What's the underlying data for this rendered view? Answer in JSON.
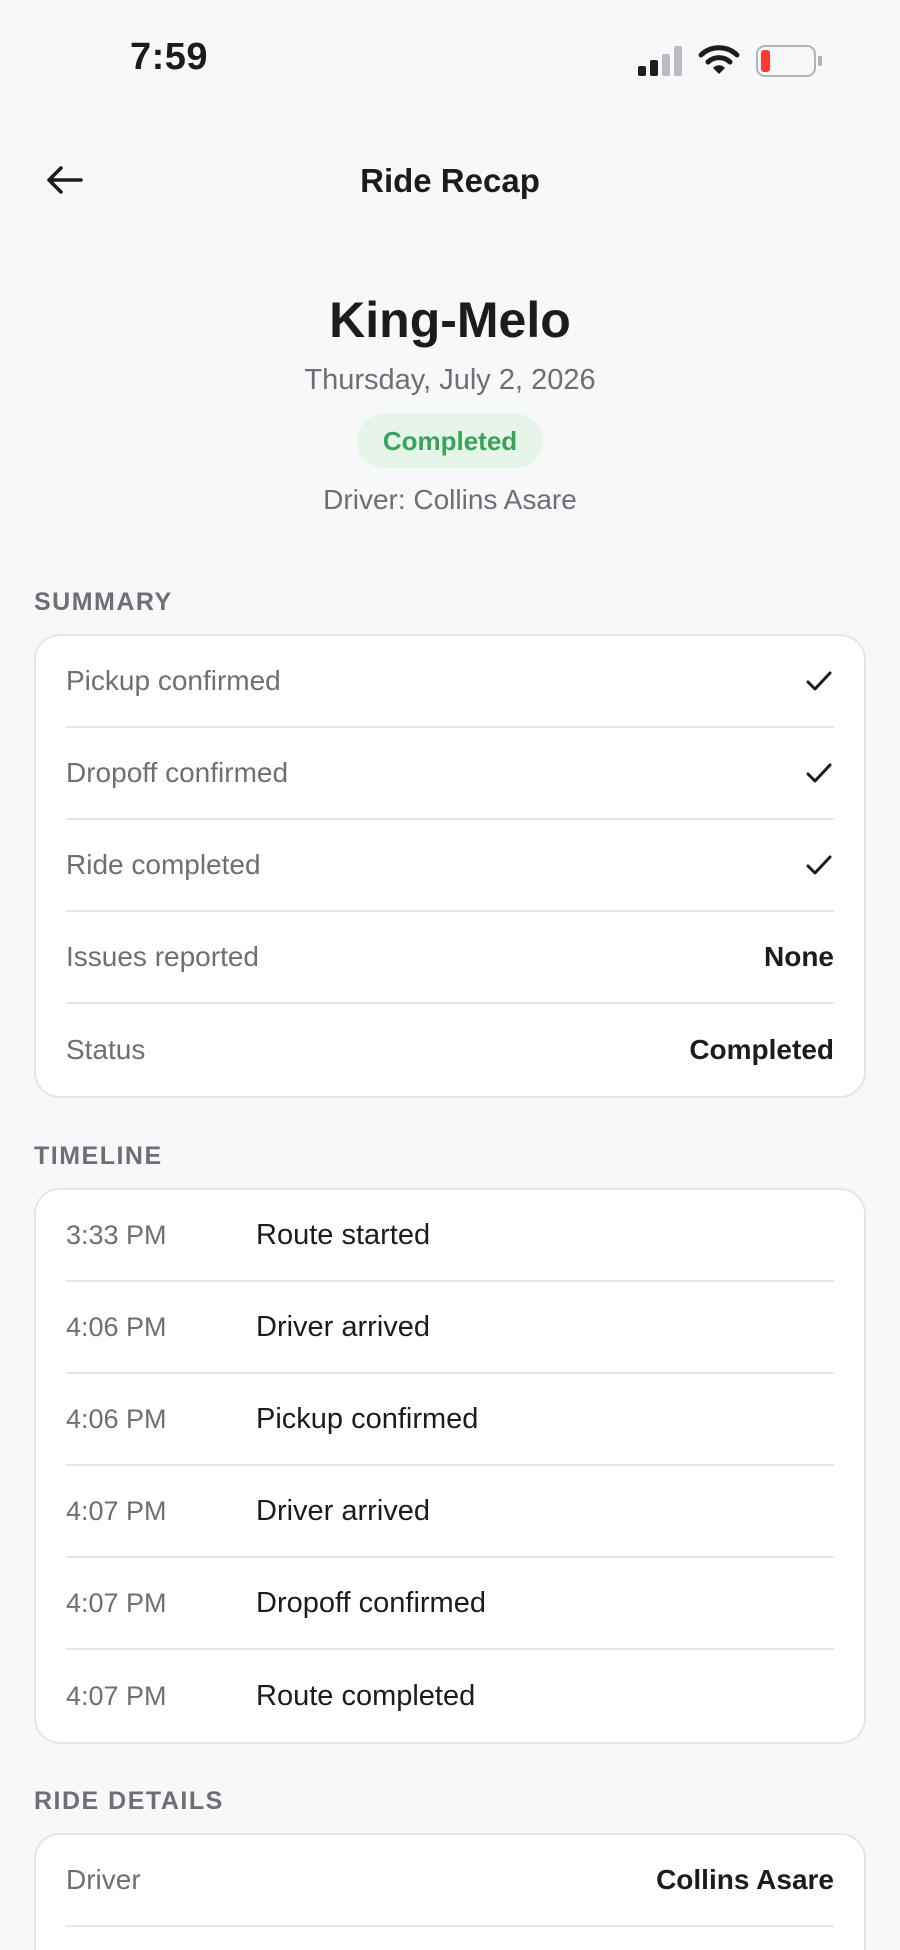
{
  "status_bar": {
    "time": "7:59"
  },
  "nav": {
    "title": "Ride Recap"
  },
  "header": {
    "title": "King-Melo",
    "date": "Thursday, July 2, 2026",
    "status_badge": "Completed",
    "driver_line": "Driver: Collins Asare"
  },
  "summary": {
    "section_label": "SUMMARY",
    "rows": [
      {
        "label": "Pickup confirmed",
        "icon": "checkmark-icon"
      },
      {
        "label": "Dropoff confirmed",
        "icon": "checkmark-icon"
      },
      {
        "label": "Ride completed",
        "icon": "checkmark-icon"
      },
      {
        "label": "Issues reported",
        "value": "None"
      },
      {
        "label": "Status",
        "value": "Completed"
      }
    ]
  },
  "timeline": {
    "section_label": "TIMELINE",
    "events": [
      {
        "time": "3:33 PM",
        "event": "Route started"
      },
      {
        "time": "4:06 PM",
        "event": "Driver arrived"
      },
      {
        "time": "4:06 PM",
        "event": "Pickup confirmed"
      },
      {
        "time": "4:07 PM",
        "event": "Driver arrived"
      },
      {
        "time": "4:07 PM",
        "event": "Dropoff confirmed"
      },
      {
        "time": "4:07 PM",
        "event": "Route completed"
      }
    ]
  },
  "ride_details": {
    "section_label": "RIDE DETAILS",
    "rows": [
      {
        "label": "Driver",
        "value": "Collins Asare"
      }
    ]
  },
  "colors": {
    "background": "#f7f8fa",
    "badge_bg": "#e7f4ea",
    "badge_text": "#3aa35a",
    "battery_low": "#ff3b30"
  }
}
